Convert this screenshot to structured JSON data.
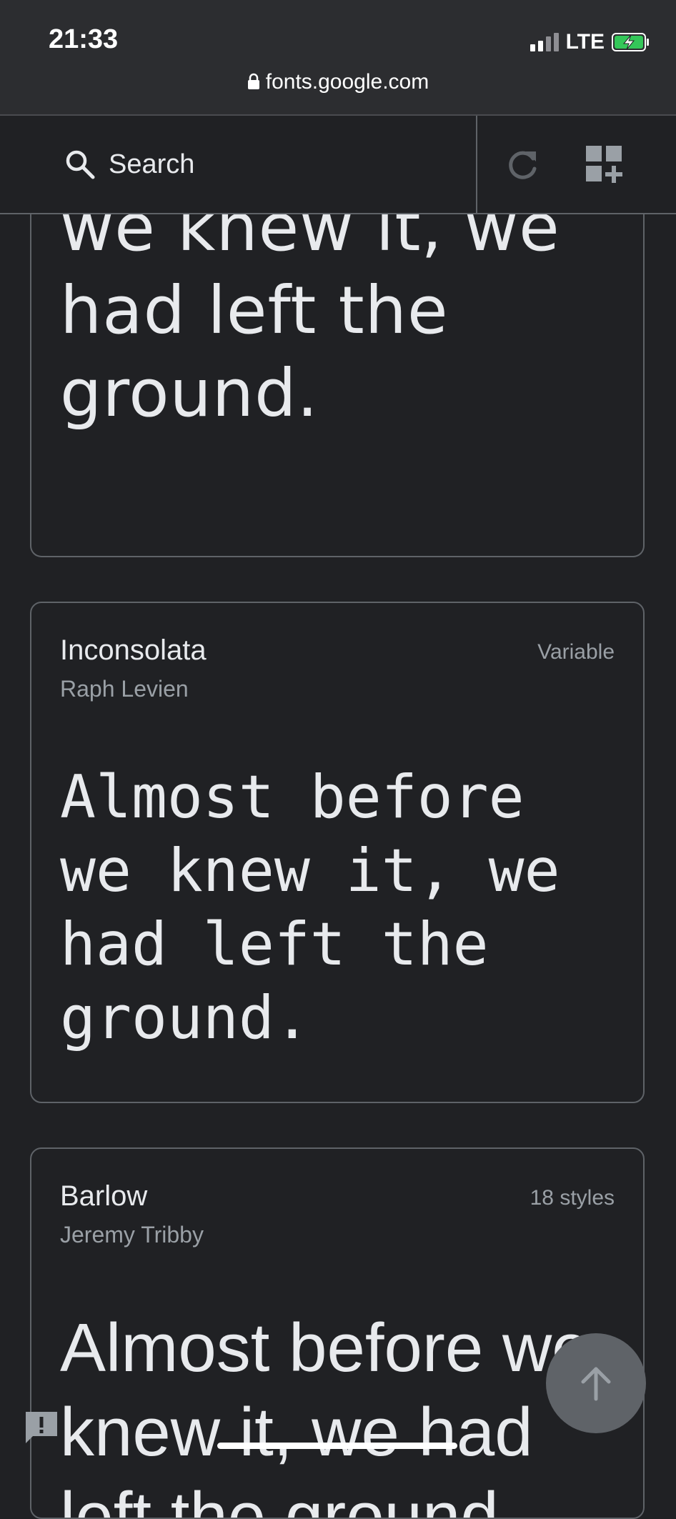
{
  "status_bar": {
    "time": "21:33",
    "network": "LTE"
  },
  "browser": {
    "url": "fonts.google.com"
  },
  "toolbar": {
    "search_label": "Search"
  },
  "cards": [
    {
      "sample": "Almost before we knew it, we had left the ground."
    },
    {
      "name": "Inconsolata",
      "author": "Raph Levien",
      "styles": "Variable",
      "sample": "Almost before we knew it, we had left the ground."
    },
    {
      "name": "Barlow",
      "author": "Jeremy Tribby",
      "styles": "18 styles",
      "sample": "Almost before we knew it, we had left the ground."
    }
  ],
  "icons": {
    "search": "search-icon",
    "refresh": "refresh-icon",
    "collection": "collection-icon",
    "scroll_top": "arrow-up-icon",
    "feedback": "feedback-icon",
    "lock": "lock-icon",
    "battery": "battery-charging-icon"
  },
  "colors": {
    "background": "#202124",
    "card_border": "#5f6368",
    "primary_text": "#e8eaed",
    "secondary_text": "#9aa0a6",
    "battery_charge": "#34c759"
  }
}
